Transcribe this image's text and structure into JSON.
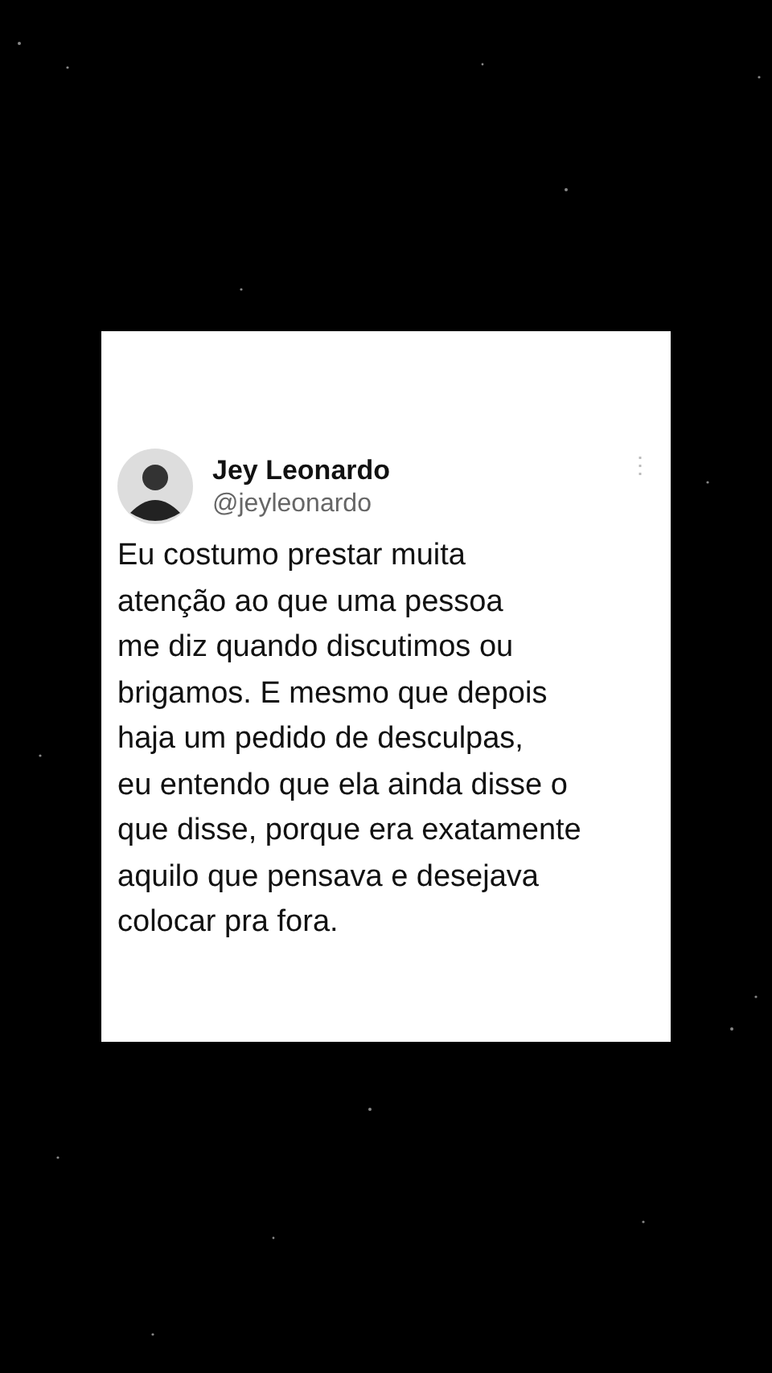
{
  "post": {
    "author": {
      "name": "Jey Leonardo",
      "handle": "@jeyleonardo"
    },
    "more_icon": "⋮",
    "lines": [
      "Eu costumo prestar muita",
      "atenção ao que uma pessoa",
      "me diz quando discutimos ou",
      "brigamos. E mesmo que depois",
      "haja um pedido de desculpas,",
      "eu entendo que ela ainda disse o",
      "que disse, porque era exatamente",
      "aquilo que pensava e desejava",
      "colocar pra fora."
    ]
  }
}
